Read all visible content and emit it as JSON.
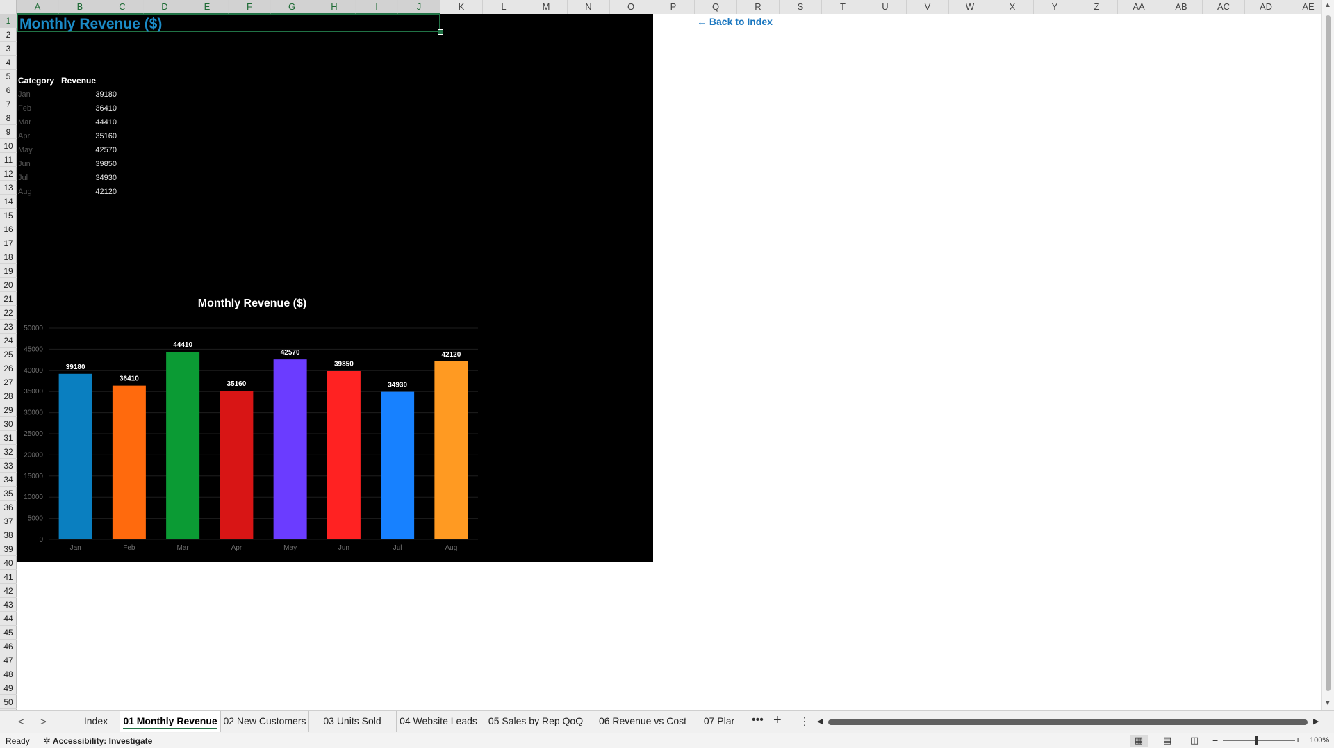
{
  "sheet": {
    "title": "Monthly Revenue ($)",
    "back_link": "← Back to Index",
    "table_headers": [
      "Category",
      "Revenue"
    ],
    "table_rows": [
      {
        "category": "Jan",
        "revenue": "39180"
      },
      {
        "category": "Feb",
        "revenue": "36410"
      },
      {
        "category": "Mar",
        "revenue": "44410"
      },
      {
        "category": "Apr",
        "revenue": "35160"
      },
      {
        "category": "May",
        "revenue": "42570"
      },
      {
        "category": "Jun",
        "revenue": "39850"
      },
      {
        "category": "Jul",
        "revenue": "34930"
      },
      {
        "category": "Aug",
        "revenue": "42120"
      }
    ]
  },
  "columns": [
    "A",
    "B",
    "C",
    "D",
    "E",
    "F",
    "G",
    "H",
    "I",
    "J",
    "K",
    "L",
    "M",
    "N",
    "O",
    "P",
    "Q",
    "R",
    "S",
    "T",
    "U",
    "V",
    "W",
    "X",
    "Y",
    "Z",
    "AA",
    "AB",
    "AC",
    "AD",
    "AE"
  ],
  "selected_columns": [
    "A",
    "B",
    "C",
    "D",
    "E",
    "F",
    "G",
    "H",
    "I",
    "J"
  ],
  "rows": [
    "1",
    "2",
    "3",
    "4",
    "5",
    "6",
    "7",
    "8",
    "9",
    "10",
    "11",
    "12",
    "13",
    "14",
    "15",
    "16",
    "17",
    "18",
    "19",
    "20",
    "21",
    "22",
    "23",
    "24",
    "25",
    "26",
    "27",
    "28",
    "29",
    "30",
    "31",
    "32",
    "33",
    "34",
    "35",
    "36",
    "37",
    "38",
    "39",
    "40",
    "41",
    "42",
    "43",
    "44",
    "45",
    "46",
    "47",
    "48",
    "49",
    "50"
  ],
  "chart_data": {
    "type": "bar",
    "title": "Monthly Revenue ($)",
    "categories": [
      "Jan",
      "Feb",
      "Mar",
      "Apr",
      "May",
      "Jun",
      "Jul",
      "Aug"
    ],
    "values": [
      39180,
      36410,
      44410,
      35160,
      42570,
      39850,
      34930,
      42120
    ],
    "colors": [
      "#0a7fc0",
      "#ff6a0d",
      "#0b9b34",
      "#d81515",
      "#6b3cff",
      "#ff2222",
      "#1781ff",
      "#ff9a22"
    ],
    "ylim": [
      0,
      50000
    ],
    "yticks": [
      "0",
      "5000",
      "10000",
      "15000",
      "20000",
      "25000",
      "30000",
      "35000",
      "40000",
      "45000",
      "50000"
    ],
    "background": "#000000",
    "grid": true,
    "data_labels": true
  },
  "tabs": [
    {
      "label": "Index",
      "active": false
    },
    {
      "label": "01 Monthly Revenue",
      "active": true
    },
    {
      "label": "02 New Customers",
      "active": false
    },
    {
      "label": "03 Units Sold",
      "active": false
    },
    {
      "label": "04 Website Leads",
      "active": false
    },
    {
      "label": "05 Sales by Rep QoQ",
      "active": false
    },
    {
      "label": "06 Revenue vs Cost",
      "active": false
    },
    {
      "label": "07 Plar",
      "active": false
    }
  ],
  "tabbar": {
    "prev": "<",
    "next": ">",
    "more": "•••",
    "add": "+",
    "menu": "⋮"
  },
  "status": {
    "ready": "Ready",
    "accessibility": "Accessibility: Investigate",
    "zoom": "100%",
    "zoom_minus": "−",
    "zoom_plus": "+"
  },
  "icons": {
    "accessibility": "accessibility-icon",
    "normal_view": "normal-view-icon",
    "page_layout": "page-layout-icon",
    "page_break": "page-break-preview-icon"
  },
  "accent_color": "#217346"
}
